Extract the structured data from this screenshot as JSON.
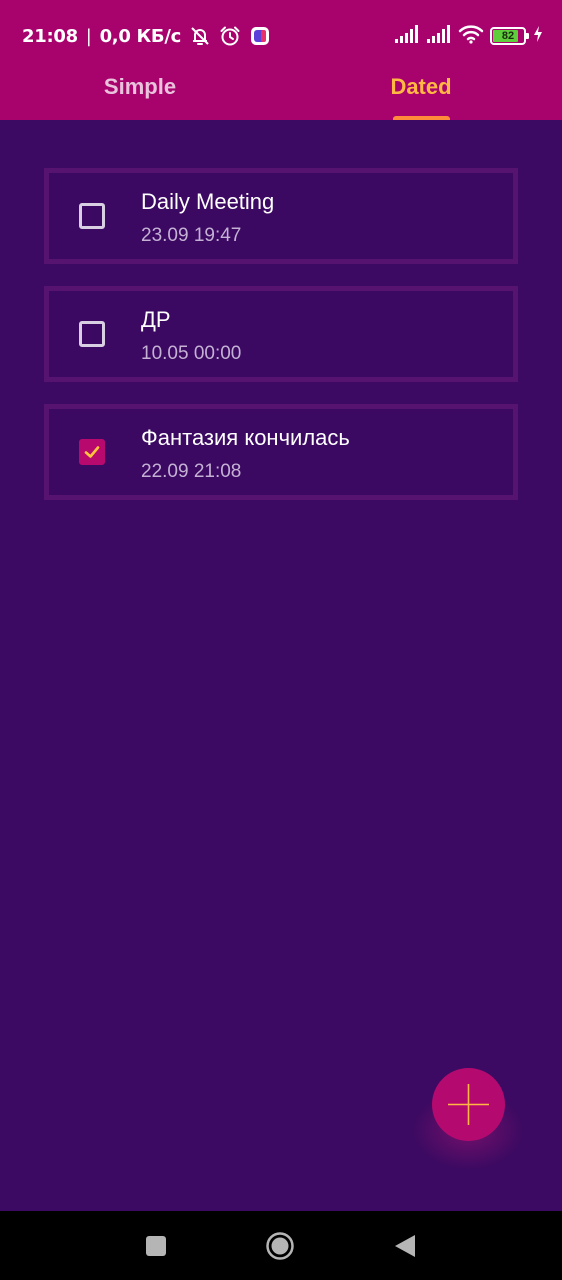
{
  "status_bar": {
    "time": "21:08",
    "separator": "|",
    "network_speed": "0,0 КБ/с",
    "battery_level": "82",
    "icons": [
      "muted-notifications-icon",
      "alarm-icon",
      "app-notification-icon",
      "signal-icon",
      "signal-icon",
      "wifi-icon",
      "battery-icon",
      "charging-icon"
    ]
  },
  "tabs": [
    {
      "label": "Simple",
      "selected": false
    },
    {
      "label": "Dated",
      "selected": true
    }
  ],
  "tasks": [
    {
      "title": "Daily Meeting",
      "date": "23.09 19:47",
      "checked": false
    },
    {
      "title": "ДР",
      "date": "10.05 00:00",
      "checked": false
    },
    {
      "title": "Фантазия кончилась",
      "date": "22.09 21:08",
      "checked": true
    }
  ],
  "fab": {
    "icon": "plus-icon"
  },
  "navigation": {
    "icons": [
      "recents-icon",
      "home-icon",
      "back-icon"
    ]
  },
  "colors": {
    "header": "#a8036d",
    "background": "#3c0a62",
    "tab_selected": "#ffb844",
    "tab_unselected": "#e9c3db",
    "card_border": "#56136f",
    "checkbox_checked": "#b80a6e",
    "checkmark": "#ffc53d",
    "fab": "#b40a6f",
    "fab_icon": "#ffb844"
  }
}
